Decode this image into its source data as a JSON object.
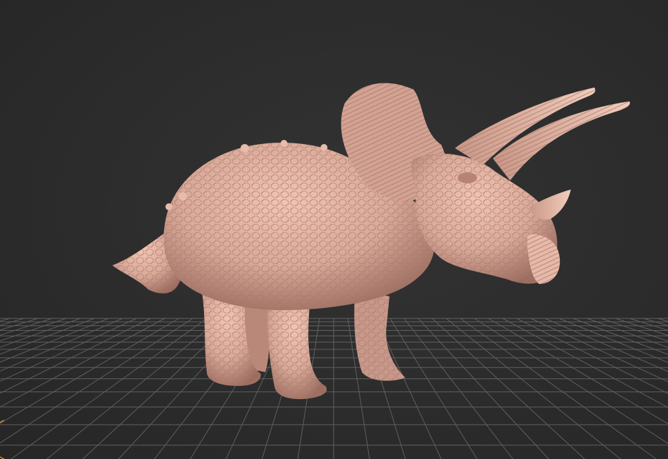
{
  "viewport": {
    "background_color": "#2b2b2b",
    "grid_color": "#6a6a6a",
    "model_color": "#d9a999",
    "model": "triceratops-sculpt"
  },
  "gizmo": {
    "icon": "axis-gizmo-icon",
    "color": "#c98a2a"
  }
}
